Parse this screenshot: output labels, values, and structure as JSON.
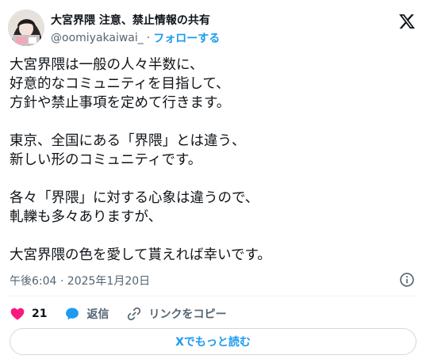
{
  "author": {
    "display_name": "大宮界隈 注意、禁止情報の共有",
    "handle": "@oomiyakaiwai_",
    "separator": "·",
    "follow_label": "フォローする",
    "avatar_icon": "profile-avatar"
  },
  "tweet": {
    "lines": [
      "大宮界隈は一般の人々半数に、",
      "好意的なコミュニティを目指して、",
      "方針や禁止事項を定めて行きます。",
      "",
      "東京、全国にある「界隈」とは違う、",
      "新しい形のコミュニティです。",
      "",
      "各々「界隈」に対する心象は違うので、",
      "軋轢も多々ありますが、",
      "",
      "大宮界隈の色を愛して貰えれば幸いです。"
    ],
    "timestamp": "午後6:04 · 2025年1月20日"
  },
  "actions": {
    "like_count": "21",
    "reply_label": "返信",
    "copy_link_label": "リンクをコピー"
  },
  "read_more_label": "Xでもっと読む",
  "colors": {
    "accent": "#1d9bf0",
    "like": "#f91880",
    "text": "#0f1419",
    "muted": "#536471"
  },
  "icons": [
    "x-logo-icon",
    "info-icon",
    "heart-icon",
    "reply-icon",
    "link-icon"
  ]
}
